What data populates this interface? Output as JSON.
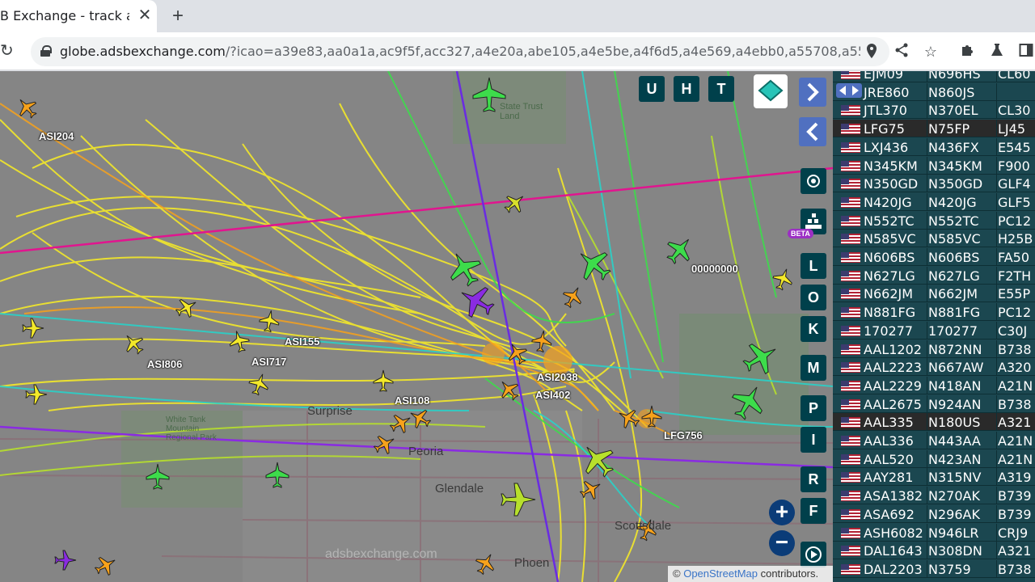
{
  "tab": {
    "title": "B Exchange - track a",
    "close": "✕",
    "new_tab": "+"
  },
  "toolbar": {
    "reload": "↻",
    "url_host": "globe.adsbexchange.com",
    "url_rest": "/?icao=a39e83,aa0a1a,ac9f5f,acc327,a4e20a,abe105,a4e5be,a4f6d5,a4e569,a4ebb0,a55708,a55e76,a4f31e,a6…",
    "icons": [
      "location-pin-icon",
      "share-icon",
      "star-icon",
      "puzzle-icon",
      "flask-icon",
      "sidebar-icon"
    ]
  },
  "map": {
    "buttons": {
      "u": "U",
      "h": "H",
      "t": "T",
      "l": "L",
      "o": "O",
      "k": "K",
      "m": "M",
      "p": "P",
      "i": "I",
      "r": "R",
      "f": "F"
    },
    "beta": "BETA",
    "zoom_in": "+",
    "zoom_out": "−",
    "brand": "adsbexchange.com",
    "attribution_prefix": "© ",
    "attribution_link": "OpenStreetMap",
    "attribution_suffix": " contributors.",
    "cities": {
      "surprise": "Surprise",
      "peoria": "Peoria",
      "glendale": "Glendale",
      "scottsdale": "Scottsdale",
      "phoenix": "Phoen",
      "white_tank": "White Tank Mountain Regional Park",
      "state_trust": "State Trust Land"
    },
    "aircraft_labels": {
      "asi204": "ASI204",
      "asi155": "ASI155",
      "asi806": "ASI806",
      "asi717": "ASI717",
      "asi108": "ASI108",
      "asi2038": "ASI2038",
      "asi402": "ASI402",
      "lfg756": "LFG756",
      "zeros": "00000000"
    }
  },
  "colors": {
    "sidebar_bg": "#1b4750",
    "button_bg": "#00404b",
    "nav_blue": "#5070c0"
  },
  "sidebar": {
    "rows": [
      {
        "callsign": "EJM09",
        "reg": "N696HS",
        "type": "CL60"
      },
      {
        "callsign": "JRE860",
        "reg": "N860JS",
        "type": ""
      },
      {
        "callsign": "JTL370",
        "reg": "N370EL",
        "type": "CL30"
      },
      {
        "callsign": "LFG75",
        "reg": "N75FP",
        "type": "LJ45"
      },
      {
        "callsign": "LXJ436",
        "reg": "N436FX",
        "type": "E545"
      },
      {
        "callsign": "N345KM",
        "reg": "N345KM",
        "type": "F900"
      },
      {
        "callsign": "N350GD",
        "reg": "N350GD",
        "type": "GLF4"
      },
      {
        "callsign": "N420JG",
        "reg": "N420JG",
        "type": "GLF5"
      },
      {
        "callsign": "N552TC",
        "reg": "N552TC",
        "type": "PC12"
      },
      {
        "callsign": "N585VC",
        "reg": "N585VC",
        "type": "H25B"
      },
      {
        "callsign": "N606BS",
        "reg": "N606BS",
        "type": "FA50"
      },
      {
        "callsign": "N627LG",
        "reg": "N627LG",
        "type": "F2TH"
      },
      {
        "callsign": "N662JM",
        "reg": "N662JM",
        "type": "E55P"
      },
      {
        "callsign": "N881FG",
        "reg": "N881FG",
        "type": "PC12"
      },
      {
        "callsign": "170277",
        "reg": "170277",
        "type": "C30J"
      },
      {
        "callsign": "AAL1202",
        "reg": "N872NN",
        "type": "B738"
      },
      {
        "callsign": "AAL2223",
        "reg": "N667AW",
        "type": "A320"
      },
      {
        "callsign": "AAL2229",
        "reg": "N418AN",
        "type": "A21N"
      },
      {
        "callsign": "AAL2675",
        "reg": "N924AN",
        "type": "B738"
      },
      {
        "callsign": "AAL335",
        "reg": "N180US",
        "type": "A321"
      },
      {
        "callsign": "AAL336",
        "reg": "N443AA",
        "type": "A21N"
      },
      {
        "callsign": "AAL520",
        "reg": "N423AN",
        "type": "A21N"
      },
      {
        "callsign": "AAY281",
        "reg": "N315NV",
        "type": "A319"
      },
      {
        "callsign": "ASA1382",
        "reg": "N270AK",
        "type": "B739"
      },
      {
        "callsign": "ASA692",
        "reg": "N296AK",
        "type": "B739"
      },
      {
        "callsign": "ASH6082",
        "reg": "N946LR",
        "type": "CRJ9"
      },
      {
        "callsign": "DAL1643",
        "reg": "N308DN",
        "type": "A321"
      },
      {
        "callsign": "DAL2203",
        "reg": "N3759",
        "type": "B738"
      }
    ]
  }
}
